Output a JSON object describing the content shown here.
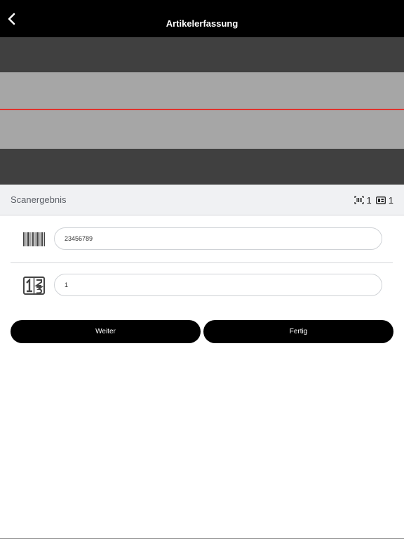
{
  "header": {
    "title": "Artikelerfassung",
    "back_icon": "chevron-left-icon"
  },
  "scanner": {
    "scan_line_color": "#e0322d"
  },
  "result": {
    "label": "Scanergebnis",
    "barcode_count": "1",
    "quantity_count": "1",
    "barcode_count_icon": "barcode-scan-icon",
    "quantity_count_icon": "quantity-box-icon"
  },
  "fields": {
    "barcode_value": "23456789",
    "barcode_icon": "barcode-icon",
    "quantity_value": "1",
    "quantity_icon": "quantity-icon"
  },
  "buttons": {
    "next_label": "Weiter",
    "done_label": "Fertig"
  }
}
